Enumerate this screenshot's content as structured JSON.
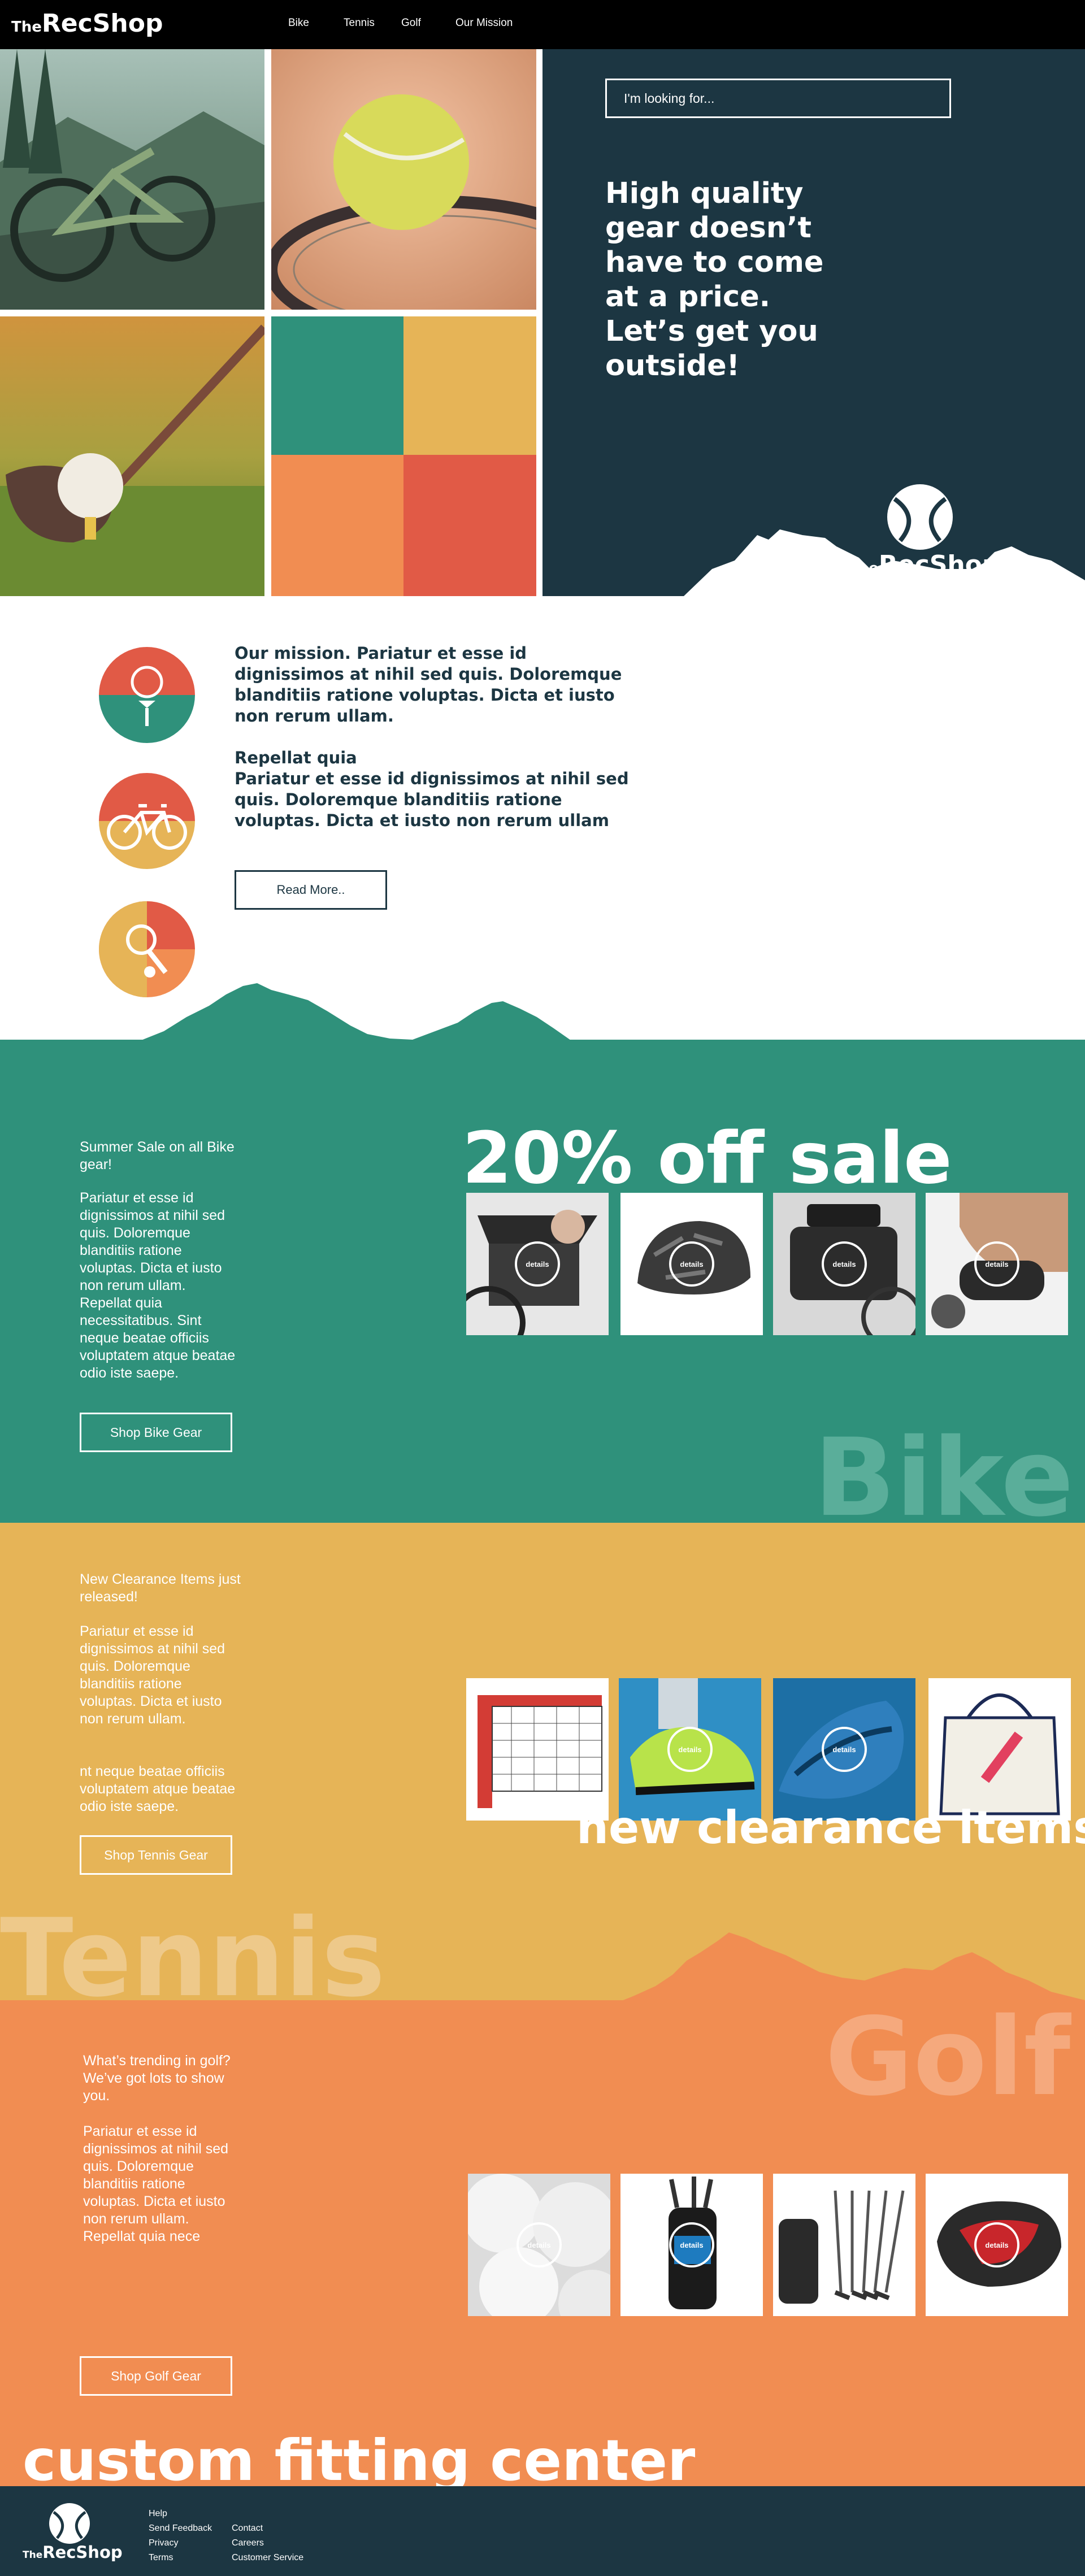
{
  "nav": {
    "brand_the": "The",
    "brand_rec": "RecShop",
    "links": [
      "Bike",
      "Tennis",
      "Golf",
      "Our Mission"
    ]
  },
  "hero": {
    "search_placeholder": "I'm looking for...",
    "headline": "High quality gear doesn’t have to come at a price. Let’s get you outside!",
    "brand_the": "The",
    "brand_rec": "RecShop"
  },
  "mission": {
    "paragraph1": "Our mission. Pariatur et esse id dignissimos at nihil sed quis. Doloremque blanditiis ratione voluptas. Dicta et iusto non rerum ullam.",
    "paragraph2_title": "Repellat quia",
    "paragraph2_body": "Pariatur et esse id dignissimos at nihil sed quis. Doloremque blanditiis ratione voluptas. Dicta et iusto non rerum ullam",
    "read_more": "Read More.."
  },
  "bike": {
    "intro": "Summer Sale on all Bike gear!",
    "body": "Pariatur et esse id dignissimos at nihil sed quis. Doloremque blanditiis ratione voluptas. Dicta et iusto non rerum ullam. Repellat quia necessitatibus. Sint neque beatae officiis voluptatem atque beatae odio iste saepe.",
    "button": "Shop Bike Gear",
    "headline": "20% off sale",
    "watermark": "Bike",
    "details_label": "details"
  },
  "tennis": {
    "intro": "New Clearance Items just released!",
    "body": "Pariatur et esse id dignissimos at nihil sed quis. Doloremque blanditiis ratione voluptas. Dicta et iusto non rerum ullam.",
    "body2": "nt neque beatae officiis voluptatem atque beatae odio iste saepe.",
    "button": "Shop Tennis Gear",
    "headline": "new clearance items",
    "watermark": "Tennis",
    "details_label": "details"
  },
  "golf": {
    "intro": "What’s trending in golf? We’ve got lots to show you.",
    "body": "Pariatur et esse id dignissimos at nihil sed quis. Doloremque blanditiis ratione voluptas. Dicta et iusto non rerum ullam. Repellat quia nece",
    "button": "Shop Golf Gear",
    "headline": "custom fitting center",
    "watermark": "Golf",
    "details_label": "details"
  },
  "footer": {
    "brand_the": "The",
    "brand_rec": "RecShop",
    "col1": [
      "Help",
      "Send Feedback",
      "Privacy",
      "Terms"
    ],
    "col2": [
      "Contact",
      "Careers",
      "Customer Service"
    ]
  },
  "colors": {
    "navy": "#1c3642",
    "teal": "#2f917b",
    "mustard": "#e6b457",
    "orange": "#f18d52",
    "red": "#e15a46"
  }
}
